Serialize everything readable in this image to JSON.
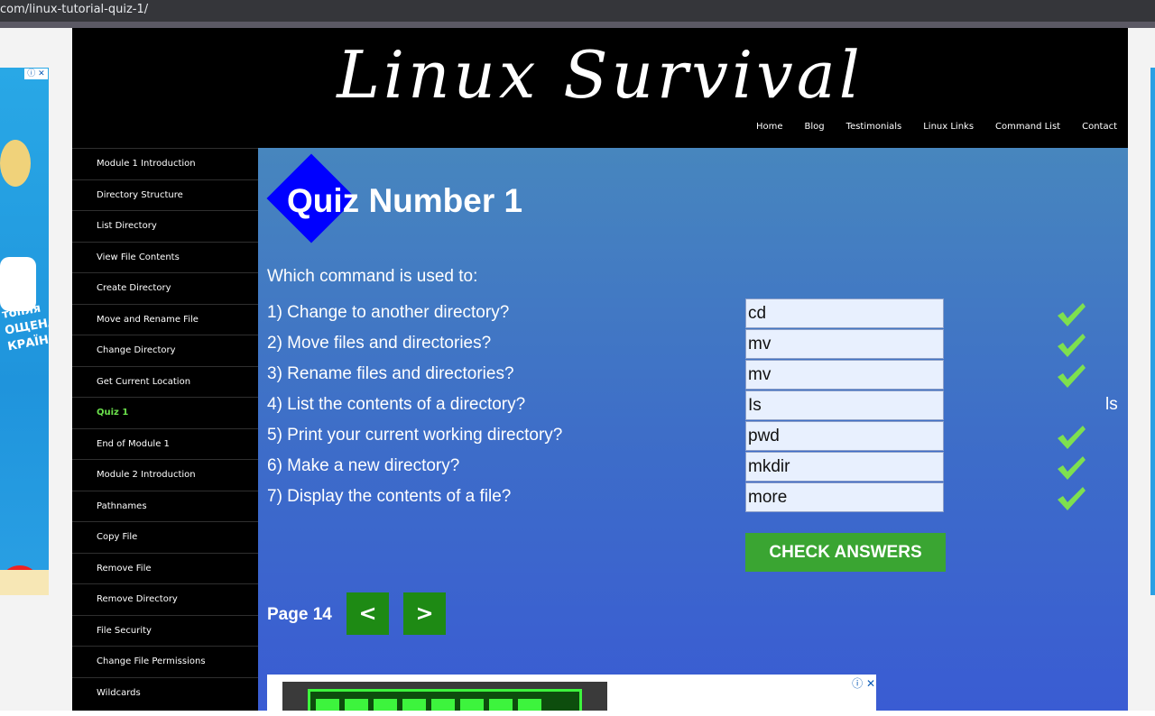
{
  "browser": {
    "url": "com/linux-tutorial-quiz-1/"
  },
  "site": {
    "logo": "Linux Survival",
    "nav": [
      "Home",
      "Blog",
      "Testimonials",
      "Linux Links",
      "Command List",
      "Contact"
    ]
  },
  "sidebar": {
    "items": [
      {
        "label": "Module 1 Introduction",
        "active": false
      },
      {
        "label": "Directory Structure",
        "active": false
      },
      {
        "label": "List Directory",
        "active": false
      },
      {
        "label": "View File Contents",
        "active": false
      },
      {
        "label": "Create Directory",
        "active": false
      },
      {
        "label": "Move and Rename File",
        "active": false
      },
      {
        "label": "Change Directory",
        "active": false
      },
      {
        "label": "Get Current Location",
        "active": false
      },
      {
        "label": "Quiz 1",
        "active": true
      },
      {
        "label": "End of Module 1",
        "active": false
      },
      {
        "label": "Module 2 Introduction",
        "active": false
      },
      {
        "label": "Pathnames",
        "active": false
      },
      {
        "label": "Copy File",
        "active": false
      },
      {
        "label": "Remove File",
        "active": false
      },
      {
        "label": "Remove Directory",
        "active": false
      },
      {
        "label": "File Security",
        "active": false
      },
      {
        "label": "Change File Permissions",
        "active": false
      },
      {
        "label": "Wildcards",
        "active": false
      }
    ]
  },
  "quiz": {
    "title": "Quiz Number 1",
    "prompt": "Which command is used to:",
    "questions": [
      {
        "text": "1) Change to another directory?",
        "answer": "cd",
        "correct": true,
        "shown_answer": ""
      },
      {
        "text": "2) Move files and directories?",
        "answer": "mv",
        "correct": true,
        "shown_answer": ""
      },
      {
        "text": "3) Rename files and directories?",
        "answer": "mv",
        "correct": true,
        "shown_answer": ""
      },
      {
        "text": "4) List the contents of a directory?",
        "answer": "Is",
        "correct": false,
        "shown_answer": "ls"
      },
      {
        "text": "5) Print your current working directory?",
        "answer": "pwd",
        "correct": true,
        "shown_answer": ""
      },
      {
        "text": "6) Make a new directory?",
        "answer": "mkdir",
        "correct": true,
        "shown_answer": ""
      },
      {
        "text": "7) Display the contents of a file?",
        "answer": "more",
        "correct": true,
        "shown_answer": ""
      }
    ],
    "check_button": "CHECK ANSWERS",
    "page_label": "Page 14",
    "prev_label": "<",
    "next_label": ">"
  },
  "ads": {
    "left_text": "КС-\nИВО\nтопля\nОЩЕНА\nКРАЇНІ",
    "close_glyph": "ⓘ ✕"
  },
  "colors": {
    "check": "#7ee04f",
    "active_nav": "#6be04c",
    "button": "#3aa532"
  }
}
